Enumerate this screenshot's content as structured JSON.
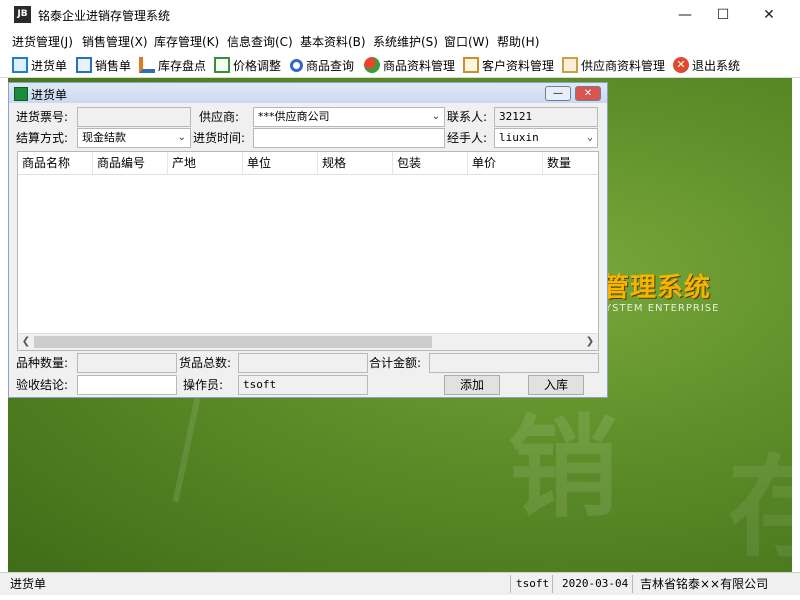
{
  "app": {
    "icon_text": "JB",
    "title": "铭泰企业进销存管理系统"
  },
  "menu": [
    "进货管理(J)",
    "销售管理(X)",
    "库存管理(K)",
    "信息查询(C)",
    "基本资料(B)",
    "系统维护(S)",
    "窗口(W)",
    "帮助(H)"
  ],
  "toolbar": [
    {
      "label": "进货单",
      "icon": "purchase-order-icon",
      "color": "#1f7fc9"
    },
    {
      "label": "销售单",
      "icon": "sales-order-icon",
      "color": "#2b6fb6"
    },
    {
      "label": "库存盘点",
      "icon": "inventory-check-icon",
      "color": "#e07a1f"
    },
    {
      "label": "价格调整",
      "icon": "price-adjust-icon",
      "color": "#3a8f3a"
    },
    {
      "label": "商品查询",
      "icon": "product-search-icon",
      "color": "#3366cc"
    },
    {
      "label": "商品资料管理",
      "icon": "product-data-icon",
      "color": "#d9472b"
    },
    {
      "label": "客户资料管理",
      "icon": "customer-data-icon",
      "color": "#c9912b"
    },
    {
      "label": "供应商资料管理",
      "icon": "supplier-data-icon",
      "color": "#c9a14a"
    },
    {
      "label": "退出系统",
      "icon": "exit-icon",
      "color": "#e04a2a"
    }
  ],
  "background": {
    "logo_text": "管理系统",
    "logo_sub": "YSTEM ENTERPRISE",
    "accent": "#f5b400"
  },
  "window": {
    "title": "进货单",
    "form": {
      "invoice_no_label": "进货票号:",
      "invoice_no_value": "",
      "supplier_label": "供应商:",
      "supplier_value": "***供应商公司",
      "contact_label": "联系人:",
      "contact_value": "32121",
      "settlement_label": "结算方式:",
      "settlement_value": "现金结款",
      "purchase_time_label": "进货时间:",
      "purchase_time_value": "",
      "handler_label": "经手人:",
      "handler_value": "liuxin"
    },
    "grid": {
      "columns": [
        "商品名称",
        "商品编号",
        "产地",
        "单位",
        "规格",
        "包装",
        "单价",
        "数量"
      ],
      "rows": []
    },
    "summary": {
      "variety_count_label": "品种数量:",
      "variety_count_value": "",
      "total_qty_label": "货品总数:",
      "total_qty_value": "",
      "total_amount_label": "合计金额:",
      "total_amount_value": "",
      "acceptance_label": "验收结论:",
      "acceptance_value": "",
      "operator_label": "操作员:",
      "operator_value": "tsoft",
      "add_button": "添加",
      "stock_in_button": "入库"
    }
  },
  "statusbar": {
    "left": "进货单",
    "user": "tsoft",
    "date": "2020-03-04",
    "company": "吉林省铭泰××有限公司"
  }
}
